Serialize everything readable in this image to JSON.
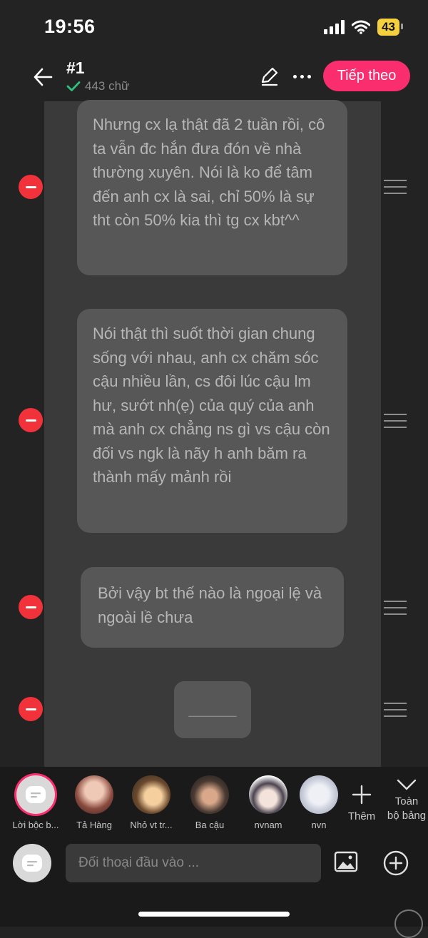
{
  "status_bar": {
    "time": "19:56",
    "battery": "43"
  },
  "header": {
    "title": "#1",
    "word_count": "443 chữ",
    "next_label": "Tiếp theo",
    "accent_color": "#fa2d6e"
  },
  "messages": [
    {
      "text": "Nhưng cx lạ thật đã 2 tuần rồi, cô ta vẫn đc hắn đưa đón về nhà thường xuyên. Nói là ko để tâm đến anh cx là sai, chỉ 50% là sự tht còn 50% kia thì tg cx kbt^^"
    },
    {
      "text": "Nói thật thì suốt thời gian chung sống với nhau, anh cx chăm sóc cậu nhiều lần, cs đôi lúc cậu lm hư, sướt nh(ẹ) của quý của anh mà anh cx chẳng ns gì vs cậu còn đối vs ngk là nãy h anh băm ra thành mấy mảnh rồi"
    },
    {
      "text": "Bởi vậy bt thế nào là ngoại lệ và ngoài lề chưa"
    },
    {
      "text": "______"
    }
  ],
  "characters": [
    {
      "name": "Lời bộc b...",
      "icon": "narrator-icon"
    },
    {
      "name": "Tả Hàng",
      "icon": "avatar"
    },
    {
      "name": "Nhỏ vt tr...",
      "icon": "avatar"
    },
    {
      "name": "Ba cậu",
      "icon": "avatar"
    },
    {
      "name": "nvnam",
      "icon": "avatar"
    },
    {
      "name": "nvn",
      "icon": "avatar"
    }
  ],
  "add_label": "Thêm",
  "all_label_line1": "Toàn",
  "all_label_line2": "bộ bảng",
  "input": {
    "placeholder": "Đối thoại đầu vào ..."
  },
  "colors": {
    "remove": "#f2323a",
    "bubble": "#575757",
    "panel": "#3a3a3a"
  }
}
